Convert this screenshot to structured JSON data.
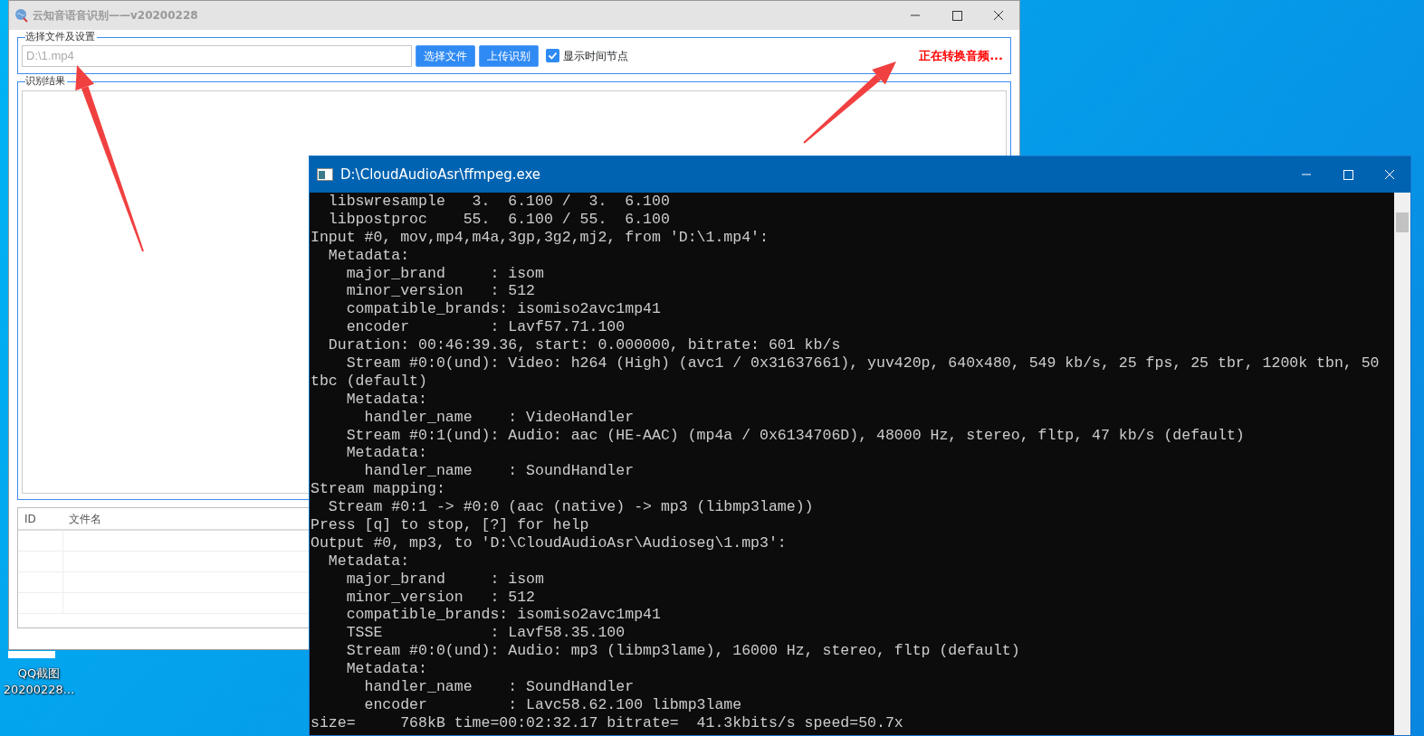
{
  "desktop_icons": [
    {
      "label_lines": [
        "QQ截图",
        "20200228..."
      ]
    }
  ],
  "app_window": {
    "title": "云知音语音识别——v20200228",
    "settings_group": {
      "legend": "选择文件及设置",
      "file_path": "D:\\1.mp4",
      "buttons": [
        "选择文件",
        "上传识别"
      ],
      "checkbox": {
        "label": "显示时间节点",
        "checked": true
      },
      "status": "正在转换音频..."
    },
    "results_group": {
      "legend": "识别结果"
    },
    "table": {
      "columns": [
        "ID",
        "文件名"
      ]
    }
  },
  "console_window": {
    "title": "D:\\CloudAudioAsr\\ffmpeg.exe",
    "lines": [
      "  libswresample   3.  6.100 /  3.  6.100",
      "  libpostproc    55.  6.100 / 55.  6.100",
      "Input #0, mov,mp4,m4a,3gp,3g2,mj2, from 'D:\\1.mp4':",
      "  Metadata:",
      "    major_brand     : isom",
      "    minor_version   : 512",
      "    compatible_brands: isomiso2avc1mp41",
      "    encoder         : Lavf57.71.100",
      "  Duration: 00:46:39.36, start: 0.000000, bitrate: 601 kb/s",
      "    Stream #0:0(und): Video: h264 (High) (avc1 / 0x31637661), yuv420p, 640x480, 549 kb/s, 25 fps, 25 tbr, 1200k tbn, 50",
      "tbc (default)",
      "    Metadata:",
      "      handler_name    : VideoHandler",
      "    Stream #0:1(und): Audio: aac (HE-AAC) (mp4a / 0x6134706D), 48000 Hz, stereo, fltp, 47 kb/s (default)",
      "    Metadata:",
      "      handler_name    : SoundHandler",
      "Stream mapping:",
      "  Stream #0:1 -> #0:0 (aac (native) -> mp3 (libmp3lame))",
      "Press [q] to stop, [?] for help",
      "Output #0, mp3, to 'D:\\CloudAudioAsr\\Audioseg\\1.mp3':",
      "  Metadata:",
      "    major_brand     : isom",
      "    minor_version   : 512",
      "    compatible_brands: isomiso2avc1mp41",
      "    TSSE            : Lavf58.35.100",
      "    Stream #0:0(und): Audio: mp3 (libmp3lame), 16000 Hz, stereo, fltp (default)",
      "    Metadata:",
      "      handler_name    : SoundHandler",
      "      encoder         : Lavc58.62.100 libmp3lame",
      "size=     768kB time=00:02:32.17 bitrate=  41.3kbits/s speed=50.7x"
    ]
  }
}
